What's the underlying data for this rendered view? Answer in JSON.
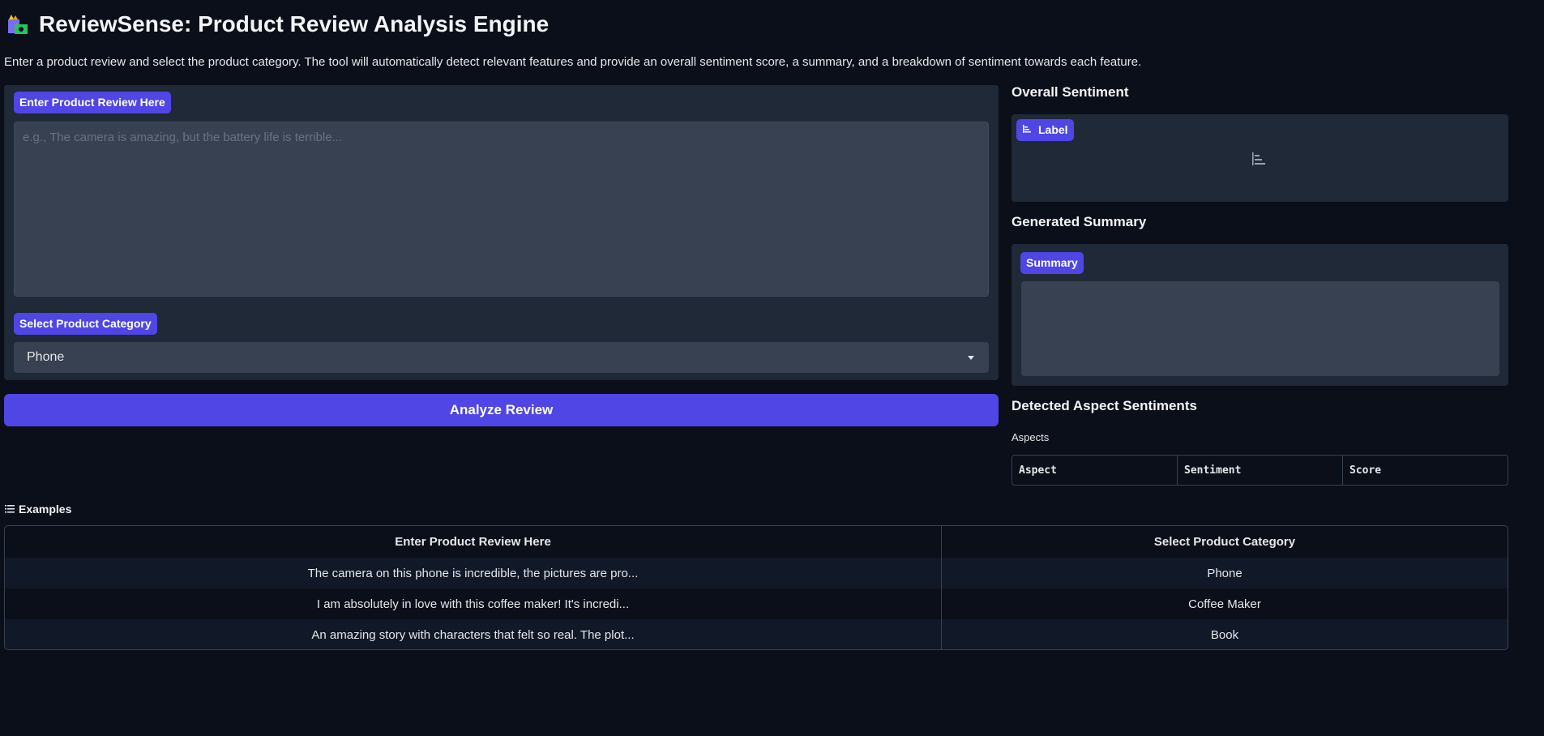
{
  "app": {
    "title": "ReviewSense: Product Review Analysis Engine",
    "description": "Enter a product review and select the product category. The tool will automatically detect relevant features and provide an overall sentiment score, a summary, and a breakdown of sentiment towards each feature."
  },
  "input": {
    "review_label": "Enter Product Review Here",
    "review_placeholder": "e.g., The camera is amazing, but the battery life is terrible...",
    "review_value": "",
    "category_label": "Select Product Category",
    "category_value": "Phone"
  },
  "actions": {
    "analyze_label": "Analyze Review"
  },
  "output": {
    "overall_heading": "Overall Sentiment",
    "label_pill": "Label",
    "summary_heading": "Generated Summary",
    "summary_pill": "Summary",
    "aspects_heading": "Detected Aspect Sentiments",
    "aspects_label": "Aspects",
    "aspects_columns": [
      "Aspect",
      "Sentiment",
      "Score"
    ]
  },
  "examples": {
    "heading": "Examples",
    "columns": [
      "Enter Product Review Here",
      "Select Product Category"
    ],
    "rows": [
      {
        "review": "The camera on this phone is incredible, the pictures are pro...",
        "category": "Phone"
      },
      {
        "review": "I am absolutely in love with this coffee maker! It's incredi...",
        "category": "Coffee Maker"
      },
      {
        "review": "An amazing story with characters that felt so real. The plot...",
        "category": "Book"
      }
    ]
  },
  "colors": {
    "background": "#0b0f19",
    "panel": "#1f2937",
    "input": "#374151",
    "accent": "#4f46e5"
  },
  "icons": [
    "logo-icon",
    "chart-icon",
    "list-icon",
    "chevron-down-icon"
  ]
}
